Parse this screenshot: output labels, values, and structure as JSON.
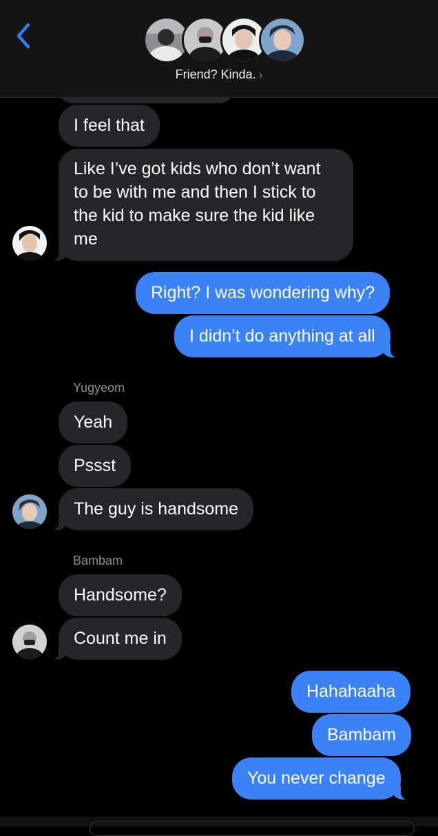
{
  "header": {
    "back_icon": "chevron-left-icon",
    "group_name": "Friend? Kinda.",
    "chevron": "›",
    "accent": "#2f7cf6"
  },
  "senders": {
    "yugyeom": "Yugyeom",
    "bambam": "Bambam"
  },
  "messages": [
    {
      "side": "in",
      "text": "I feel that"
    },
    {
      "side": "in",
      "text": "Like I’ve got kids who don’t want to be with me and then I stick to the kid to make sure the kid like me"
    },
    {
      "side": "out",
      "text": "Right? I was wondering why?"
    },
    {
      "side": "out",
      "text": "I didn’t do anything at all"
    },
    {
      "side": "in",
      "text": "Yeah"
    },
    {
      "side": "in",
      "text": "Pssst"
    },
    {
      "side": "in",
      "text": "The guy is handsome"
    },
    {
      "side": "in",
      "text": "Handsome?"
    },
    {
      "side": "in",
      "text": "Count me in"
    },
    {
      "side": "out",
      "text": "Hahahaaha"
    },
    {
      "side": "out",
      "text": "Bambam"
    },
    {
      "side": "out",
      "text": "You never change"
    }
  ],
  "colors": {
    "incoming_bubble": "#26252a",
    "outgoing_bubble": "#3b82f6",
    "background": "#000000",
    "header_background": "#151515"
  }
}
